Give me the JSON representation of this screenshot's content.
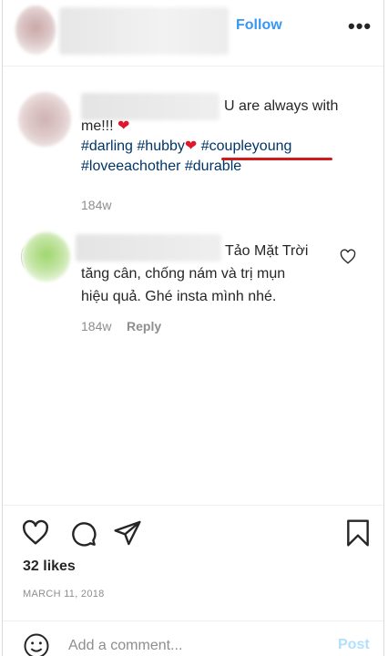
{
  "header": {
    "follow_label": "Follow",
    "more_label": "•••"
  },
  "caption": {
    "text_start": "U are always with",
    "text_me": "me!!!",
    "heart": "❤",
    "tags_line1": [
      "#darling",
      "#hubby"
    ],
    "tag_underlined": "#coupleyoung",
    "tags_line2": [
      "#loveeachother",
      "#durable"
    ],
    "time": "184w",
    "underline_color": "#d11a1a"
  },
  "reply_comment": {
    "line1": "Tảo Mặt Trời",
    "line2": "tăng cân, chống nám và trị mụn",
    "line3": "hiệu quả. Ghé insta mình nhé.",
    "time": "184w",
    "reply_label": "Reply"
  },
  "actions": {
    "like_icon": "heart-outline-icon",
    "comment_icon": "comment-bubble-icon",
    "share_icon": "paper-plane-icon",
    "save_icon": "bookmark-icon"
  },
  "likes_text": "32 likes",
  "date_text": "MARCH 11, 2018",
  "comment_box": {
    "placeholder": "Add a comment...",
    "post_label": "Post",
    "emoji_icon": "smiley-icon"
  },
  "colors": {
    "link_blue": "#3897f0",
    "hashtag": "#003569",
    "muted": "#8e8e8e",
    "post_disabled": "#b2dffc"
  }
}
